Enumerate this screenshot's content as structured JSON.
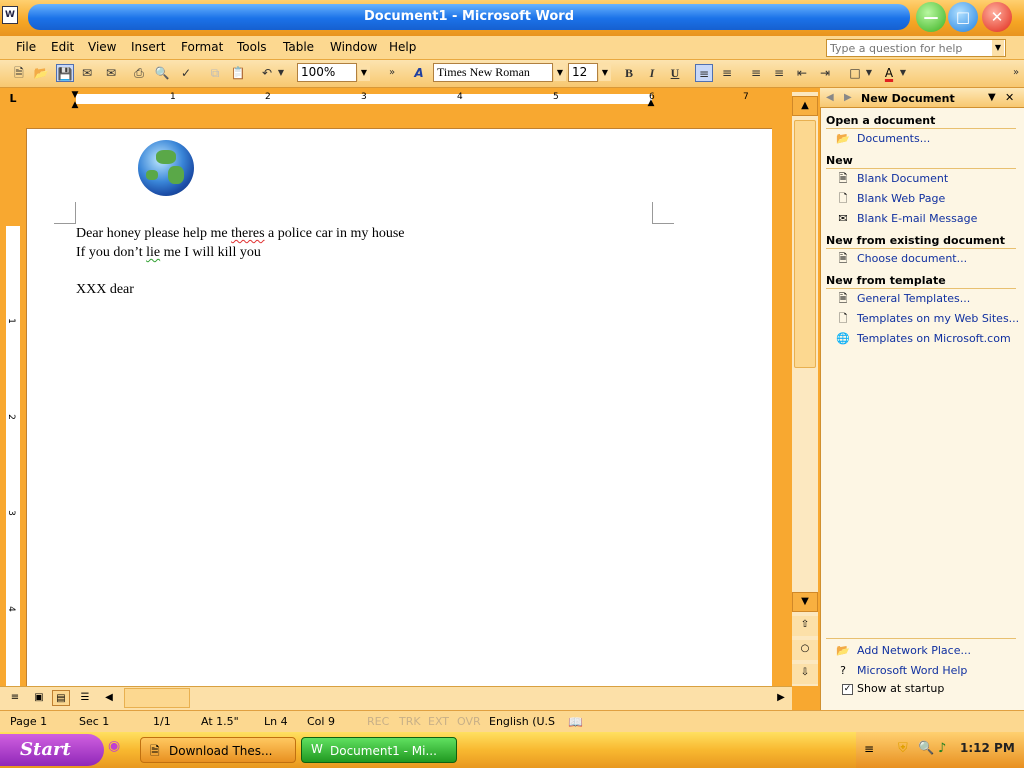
{
  "window": {
    "title": "Document1 - Microsoft Word",
    "app_icon": "W"
  },
  "menus": [
    "File",
    "Edit",
    "View",
    "Insert",
    "Format",
    "Tools",
    "Table",
    "Window",
    "Help"
  ],
  "help_box": {
    "placeholder": "Type a question for help"
  },
  "toolbar": {
    "zoom": "100%",
    "font": "Times New Roman",
    "size": "12",
    "bold": "B",
    "italic": "I",
    "underline": "U"
  },
  "ruler": {
    "corner": "L",
    "h_numbers": [
      "1",
      "2",
      "3",
      "4",
      "5",
      "6",
      "7"
    ],
    "v_numbers": [
      "1",
      "1",
      "2",
      "3",
      "4"
    ]
  },
  "document": {
    "lines": [
      "Dear honey please help me theres a police car in my house",
      "If you don’t lie me I will kill you",
      "XXX dear"
    ],
    "line1_parts": [
      "Dear honey please help me ",
      "theres",
      " a police car in my house"
    ],
    "line2_parts": [
      "If you don’t ",
      "lie",
      " me I will kill you"
    ]
  },
  "task_pane": {
    "title": "New Document",
    "sections": [
      {
        "heading": "Open a document",
        "links": [
          "Documents..."
        ]
      },
      {
        "heading": "New",
        "links": [
          "Blank Document",
          "Blank Web Page",
          "Blank E-mail Message"
        ]
      },
      {
        "heading": "New from existing document",
        "links": [
          "Choose document..."
        ]
      },
      {
        "heading": "New from template",
        "links": [
          "General Templates...",
          "Templates on my Web Sites...",
          "Templates on Microsoft.com"
        ]
      }
    ],
    "footer_links": [
      "Add Network Place...",
      "Microsoft Word Help"
    ],
    "show_at_startup": "Show at startup",
    "show_at_startup_checked": true
  },
  "status": {
    "page": "Page 1",
    "sec": "Sec 1",
    "pages": "1/1",
    "at": "At 1.5\"",
    "ln": "Ln 4",
    "col": "Col 9",
    "rec": "REC",
    "trk": "TRK",
    "ext": "EXT",
    "ovr": "OVR",
    "language": "English (U.S"
  },
  "taskbar": {
    "start": "Start",
    "tasks": [
      "Download Thes...",
      "Document1 - Mi..."
    ],
    "clock": "1:12 PM"
  },
  "colors": {
    "title_blue": "#1b72e8",
    "frame_orange": "#f8a830",
    "link_blue": "#1030a0",
    "start_purple": "#9028b8"
  }
}
